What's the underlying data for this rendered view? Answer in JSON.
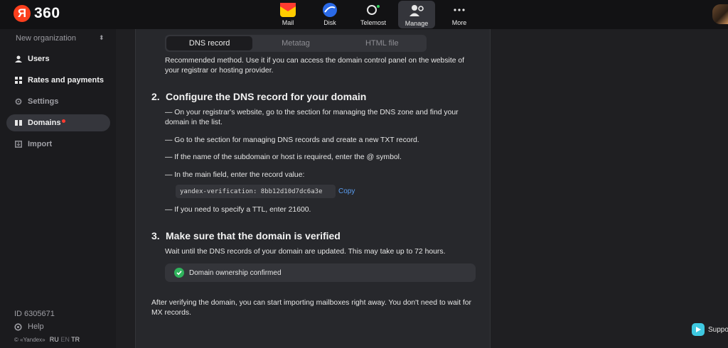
{
  "header": {
    "logo_text": "360",
    "apps": [
      {
        "label": "Mail",
        "icon": "mail-icon"
      },
      {
        "label": "Disk",
        "icon": "disk-icon"
      },
      {
        "label": "Telemost",
        "icon": "telemost-icon"
      },
      {
        "label": "Manage",
        "icon": "manage-icon"
      },
      {
        "label": "More",
        "icon": "more-icon"
      }
    ],
    "active_app": "Manage"
  },
  "sidebar": {
    "org": "New organization",
    "items": [
      {
        "label": "Users",
        "icon": "user-icon"
      },
      {
        "label": "Rates and payments",
        "icon": "grid-icon"
      },
      {
        "label": "Settings",
        "icon": "settings-icon"
      },
      {
        "label": "Domains",
        "icon": "domains-icon"
      },
      {
        "label": "Import",
        "icon": "import-icon"
      }
    ],
    "active_item": "Domains",
    "id_text": "ID 6305671",
    "help": "Help",
    "copyright": "© «Yandex»",
    "languages": [
      "RU",
      "EN",
      "TR"
    ],
    "active_language": "EN"
  },
  "main": {
    "tabs": [
      "DNS record",
      "Metatag",
      "HTML file"
    ],
    "selected_tab": "DNS record",
    "intro": "Recommended method. Use it if you can access the domain control panel on the website of your registrar or hosting provider.",
    "step2": {
      "number": "2.",
      "title": "Configure the DNS record for your domain",
      "bullets": [
        "— On your registrar's website, go to the section for managing the DNS zone and find your domain in the list.",
        "— Go to the section for managing DNS records and create a new TXT record.",
        "— If the name of the subdomain or host is required, enter the @ symbol.",
        "— In the main field, enter the record value:",
        "— If you need to specify a TTL, enter 21600."
      ],
      "record_value": "yandex-verification: 8bb12d10d7dc6a3e",
      "copy_label": "Copy"
    },
    "step3": {
      "number": "3.",
      "title": "Make sure that the domain is verified",
      "text": "Wait until the DNS records of your domain are updated. This may take up to 72 hours.",
      "status": "Domain ownership confirmed"
    },
    "footer_text": "After verifying the domain, you can start importing mailboxes right away. You don't need to wait for MX records."
  },
  "support": {
    "label": "Support"
  },
  "colors": {
    "accent": "#fc3f1d",
    "link": "#5a9df0",
    "success": "#2fb35c"
  }
}
